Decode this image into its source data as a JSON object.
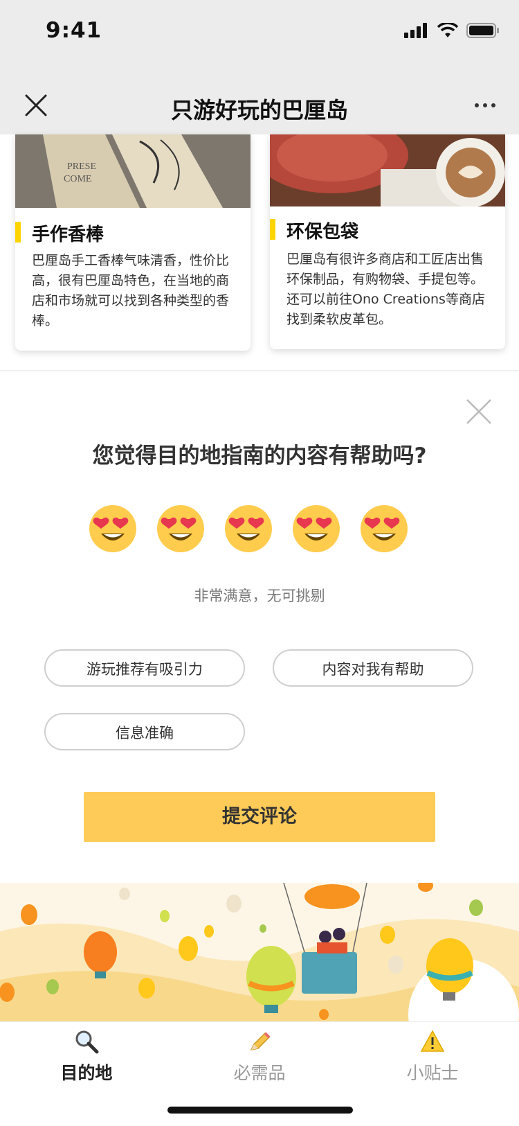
{
  "status": {
    "time": "9:41"
  },
  "nav": {
    "title": "只游好玩的巴厘岛"
  },
  "cards": [
    {
      "title": "手作香棒",
      "desc": "巴厘岛手工香棒气味清香，性价比高，很有巴厘岛特色，在当地的商店和市场就可以找到各种类型的香棒。"
    },
    {
      "title": "环保包袋",
      "desc": "巴厘岛有很许多商店和工匠店出售环保制品，有购物袋、手提包等。还可以前往Ono Creations等商店找到柔软皮革包。"
    }
  ],
  "feedback": {
    "question": "您觉得目的地指南的内容有帮助吗?",
    "rating_caption": "非常满意，无可挑剔",
    "rating": 5,
    "tags": [
      "游玩推荐有吸引力",
      "内容对我有帮助",
      "信息准确"
    ],
    "submit_label": "提交评论"
  },
  "tabs": [
    {
      "label": "目的地",
      "icon": "magnifier-icon",
      "active": true
    },
    {
      "label": "必需品",
      "icon": "pencil-icon",
      "active": false
    },
    {
      "label": "小贴士",
      "icon": "warning-icon",
      "active": false
    }
  ],
  "colors": {
    "accent": "#ffcb58",
    "title_bar": "#ffd400",
    "emoji": "#ffcc4d",
    "heart": "#e8384f"
  }
}
